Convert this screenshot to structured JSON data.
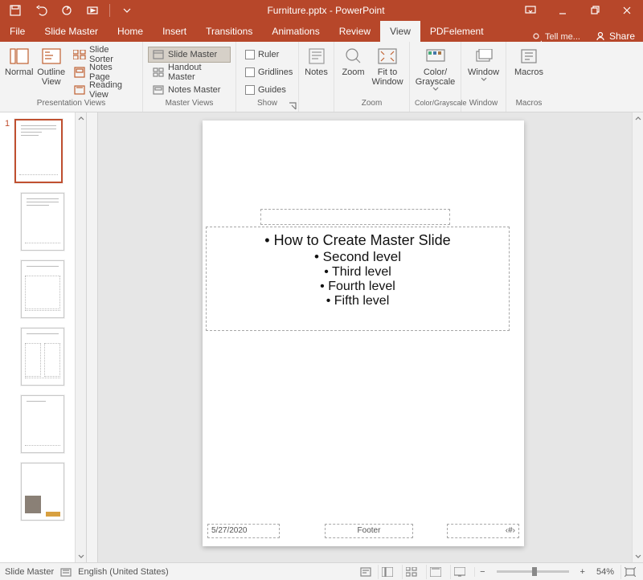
{
  "title": "Furniture.pptx - PowerPoint",
  "tabs": {
    "file": "File",
    "slide_master": "Slide Master",
    "home": "Home",
    "insert": "Insert",
    "transitions": "Transitions",
    "animations": "Animations",
    "review": "Review",
    "view": "View",
    "pdfelement": "PDFelement"
  },
  "active_tab": "view",
  "tell_me": "Tell me...",
  "share": "Share",
  "ribbon": {
    "presentation_views": {
      "label": "Presentation Views",
      "normal": "Normal",
      "outline_view": "Outline View",
      "slide_sorter": "Slide Sorter",
      "notes_page": "Notes Page",
      "reading_view": "Reading View"
    },
    "master_views": {
      "label": "Master Views",
      "slide_master": "Slide Master",
      "handout_master": "Handout Master",
      "notes_master": "Notes Master"
    },
    "show": {
      "label": "Show",
      "ruler": "Ruler",
      "gridlines": "Gridlines",
      "guides": "Guides"
    },
    "notes_group": {
      "notes": "Notes"
    },
    "zoom_group": {
      "label": "Zoom",
      "zoom": "Zoom",
      "fit": "Fit to Window"
    },
    "color_group": {
      "label": "Color/Grayscale",
      "color": "Color/ Grayscale"
    },
    "window_group": {
      "label": "Window",
      "window": "Window"
    },
    "macros_group": {
      "label": "Macros",
      "macros": "Macros"
    }
  },
  "slide": {
    "body_l1": "How to Create Master Slide",
    "body_l2": "Second level",
    "body_l3": "Third level",
    "body_l4": "Fourth level",
    "body_l5": "Fifth level",
    "date": "5/27/2020",
    "footer": "Footer",
    "num": "‹#›"
  },
  "thumb_panel": {
    "master_index": "1"
  },
  "status": {
    "view_name": "Slide Master",
    "language": "English (United States)",
    "zoom_pct": "54%"
  }
}
